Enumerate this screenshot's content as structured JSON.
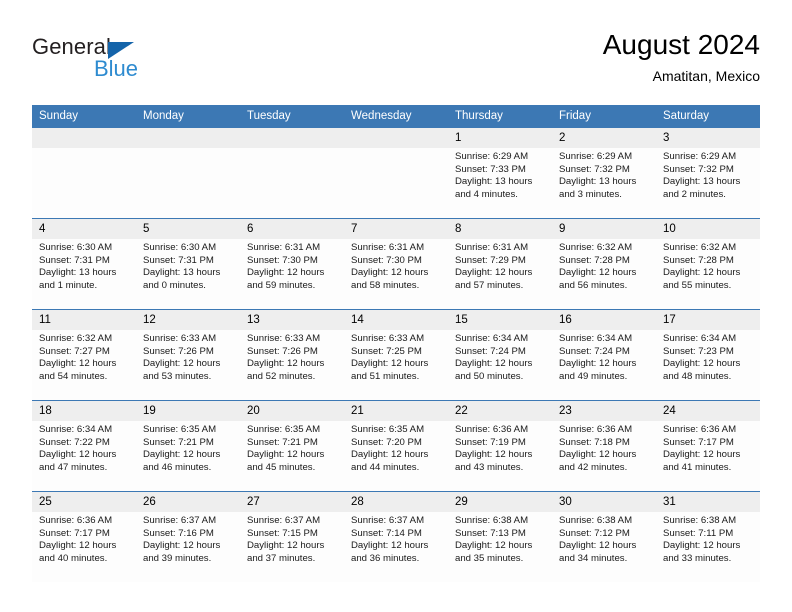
{
  "brand": {
    "name_part1": "General",
    "name_part2": "Blue"
  },
  "header": {
    "month_title": "August 2024",
    "location": "Amatitan, Mexico"
  },
  "colors": {
    "header_blue": "#3c78b4",
    "logo_blue": "#2e8bd0",
    "daynum_gray": "#eeeeee",
    "cell_white": "#fdfdfd"
  },
  "weekday_headers": [
    "Sunday",
    "Monday",
    "Tuesday",
    "Wednesday",
    "Thursday",
    "Friday",
    "Saturday"
  ],
  "weeks": [
    [
      {
        "day": "",
        "sunrise": "",
        "sunset": "",
        "daylight_line1": "",
        "daylight_line2": ""
      },
      {
        "day": "",
        "sunrise": "",
        "sunset": "",
        "daylight_line1": "",
        "daylight_line2": ""
      },
      {
        "day": "",
        "sunrise": "",
        "sunset": "",
        "daylight_line1": "",
        "daylight_line2": ""
      },
      {
        "day": "",
        "sunrise": "",
        "sunset": "",
        "daylight_line1": "",
        "daylight_line2": ""
      },
      {
        "day": "1",
        "sunrise": "Sunrise: 6:29 AM",
        "sunset": "Sunset: 7:33 PM",
        "daylight_line1": "Daylight: 13 hours",
        "daylight_line2": "and 4 minutes."
      },
      {
        "day": "2",
        "sunrise": "Sunrise: 6:29 AM",
        "sunset": "Sunset: 7:32 PM",
        "daylight_line1": "Daylight: 13 hours",
        "daylight_line2": "and 3 minutes."
      },
      {
        "day": "3",
        "sunrise": "Sunrise: 6:29 AM",
        "sunset": "Sunset: 7:32 PM",
        "daylight_line1": "Daylight: 13 hours",
        "daylight_line2": "and 2 minutes."
      }
    ],
    [
      {
        "day": "4",
        "sunrise": "Sunrise: 6:30 AM",
        "sunset": "Sunset: 7:31 PM",
        "daylight_line1": "Daylight: 13 hours",
        "daylight_line2": "and 1 minute."
      },
      {
        "day": "5",
        "sunrise": "Sunrise: 6:30 AM",
        "sunset": "Sunset: 7:31 PM",
        "daylight_line1": "Daylight: 13 hours",
        "daylight_line2": "and 0 minutes."
      },
      {
        "day": "6",
        "sunrise": "Sunrise: 6:31 AM",
        "sunset": "Sunset: 7:30 PM",
        "daylight_line1": "Daylight: 12 hours",
        "daylight_line2": "and 59 minutes."
      },
      {
        "day": "7",
        "sunrise": "Sunrise: 6:31 AM",
        "sunset": "Sunset: 7:30 PM",
        "daylight_line1": "Daylight: 12 hours",
        "daylight_line2": "and 58 minutes."
      },
      {
        "day": "8",
        "sunrise": "Sunrise: 6:31 AM",
        "sunset": "Sunset: 7:29 PM",
        "daylight_line1": "Daylight: 12 hours",
        "daylight_line2": "and 57 minutes."
      },
      {
        "day": "9",
        "sunrise": "Sunrise: 6:32 AM",
        "sunset": "Sunset: 7:28 PM",
        "daylight_line1": "Daylight: 12 hours",
        "daylight_line2": "and 56 minutes."
      },
      {
        "day": "10",
        "sunrise": "Sunrise: 6:32 AM",
        "sunset": "Sunset: 7:28 PM",
        "daylight_line1": "Daylight: 12 hours",
        "daylight_line2": "and 55 minutes."
      }
    ],
    [
      {
        "day": "11",
        "sunrise": "Sunrise: 6:32 AM",
        "sunset": "Sunset: 7:27 PM",
        "daylight_line1": "Daylight: 12 hours",
        "daylight_line2": "and 54 minutes."
      },
      {
        "day": "12",
        "sunrise": "Sunrise: 6:33 AM",
        "sunset": "Sunset: 7:26 PM",
        "daylight_line1": "Daylight: 12 hours",
        "daylight_line2": "and 53 minutes."
      },
      {
        "day": "13",
        "sunrise": "Sunrise: 6:33 AM",
        "sunset": "Sunset: 7:26 PM",
        "daylight_line1": "Daylight: 12 hours",
        "daylight_line2": "and 52 minutes."
      },
      {
        "day": "14",
        "sunrise": "Sunrise: 6:33 AM",
        "sunset": "Sunset: 7:25 PM",
        "daylight_line1": "Daylight: 12 hours",
        "daylight_line2": "and 51 minutes."
      },
      {
        "day": "15",
        "sunrise": "Sunrise: 6:34 AM",
        "sunset": "Sunset: 7:24 PM",
        "daylight_line1": "Daylight: 12 hours",
        "daylight_line2": "and 50 minutes."
      },
      {
        "day": "16",
        "sunrise": "Sunrise: 6:34 AM",
        "sunset": "Sunset: 7:24 PM",
        "daylight_line1": "Daylight: 12 hours",
        "daylight_line2": "and 49 minutes."
      },
      {
        "day": "17",
        "sunrise": "Sunrise: 6:34 AM",
        "sunset": "Sunset: 7:23 PM",
        "daylight_line1": "Daylight: 12 hours",
        "daylight_line2": "and 48 minutes."
      }
    ],
    [
      {
        "day": "18",
        "sunrise": "Sunrise: 6:34 AM",
        "sunset": "Sunset: 7:22 PM",
        "daylight_line1": "Daylight: 12 hours",
        "daylight_line2": "and 47 minutes."
      },
      {
        "day": "19",
        "sunrise": "Sunrise: 6:35 AM",
        "sunset": "Sunset: 7:21 PM",
        "daylight_line1": "Daylight: 12 hours",
        "daylight_line2": "and 46 minutes."
      },
      {
        "day": "20",
        "sunrise": "Sunrise: 6:35 AM",
        "sunset": "Sunset: 7:21 PM",
        "daylight_line1": "Daylight: 12 hours",
        "daylight_line2": "and 45 minutes."
      },
      {
        "day": "21",
        "sunrise": "Sunrise: 6:35 AM",
        "sunset": "Sunset: 7:20 PM",
        "daylight_line1": "Daylight: 12 hours",
        "daylight_line2": "and 44 minutes."
      },
      {
        "day": "22",
        "sunrise": "Sunrise: 6:36 AM",
        "sunset": "Sunset: 7:19 PM",
        "daylight_line1": "Daylight: 12 hours",
        "daylight_line2": "and 43 minutes."
      },
      {
        "day": "23",
        "sunrise": "Sunrise: 6:36 AM",
        "sunset": "Sunset: 7:18 PM",
        "daylight_line1": "Daylight: 12 hours",
        "daylight_line2": "and 42 minutes."
      },
      {
        "day": "24",
        "sunrise": "Sunrise: 6:36 AM",
        "sunset": "Sunset: 7:17 PM",
        "daylight_line1": "Daylight: 12 hours",
        "daylight_line2": "and 41 minutes."
      }
    ],
    [
      {
        "day": "25",
        "sunrise": "Sunrise: 6:36 AM",
        "sunset": "Sunset: 7:17 PM",
        "daylight_line1": "Daylight: 12 hours",
        "daylight_line2": "and 40 minutes."
      },
      {
        "day": "26",
        "sunrise": "Sunrise: 6:37 AM",
        "sunset": "Sunset: 7:16 PM",
        "daylight_line1": "Daylight: 12 hours",
        "daylight_line2": "and 39 minutes."
      },
      {
        "day": "27",
        "sunrise": "Sunrise: 6:37 AM",
        "sunset": "Sunset: 7:15 PM",
        "daylight_line1": "Daylight: 12 hours",
        "daylight_line2": "and 37 minutes."
      },
      {
        "day": "28",
        "sunrise": "Sunrise: 6:37 AM",
        "sunset": "Sunset: 7:14 PM",
        "daylight_line1": "Daylight: 12 hours",
        "daylight_line2": "and 36 minutes."
      },
      {
        "day": "29",
        "sunrise": "Sunrise: 6:38 AM",
        "sunset": "Sunset: 7:13 PM",
        "daylight_line1": "Daylight: 12 hours",
        "daylight_line2": "and 35 minutes."
      },
      {
        "day": "30",
        "sunrise": "Sunrise: 6:38 AM",
        "sunset": "Sunset: 7:12 PM",
        "daylight_line1": "Daylight: 12 hours",
        "daylight_line2": "and 34 minutes."
      },
      {
        "day": "31",
        "sunrise": "Sunrise: 6:38 AM",
        "sunset": "Sunset: 7:11 PM",
        "daylight_line1": "Daylight: 12 hours",
        "daylight_line2": "and 33 minutes."
      }
    ]
  ]
}
